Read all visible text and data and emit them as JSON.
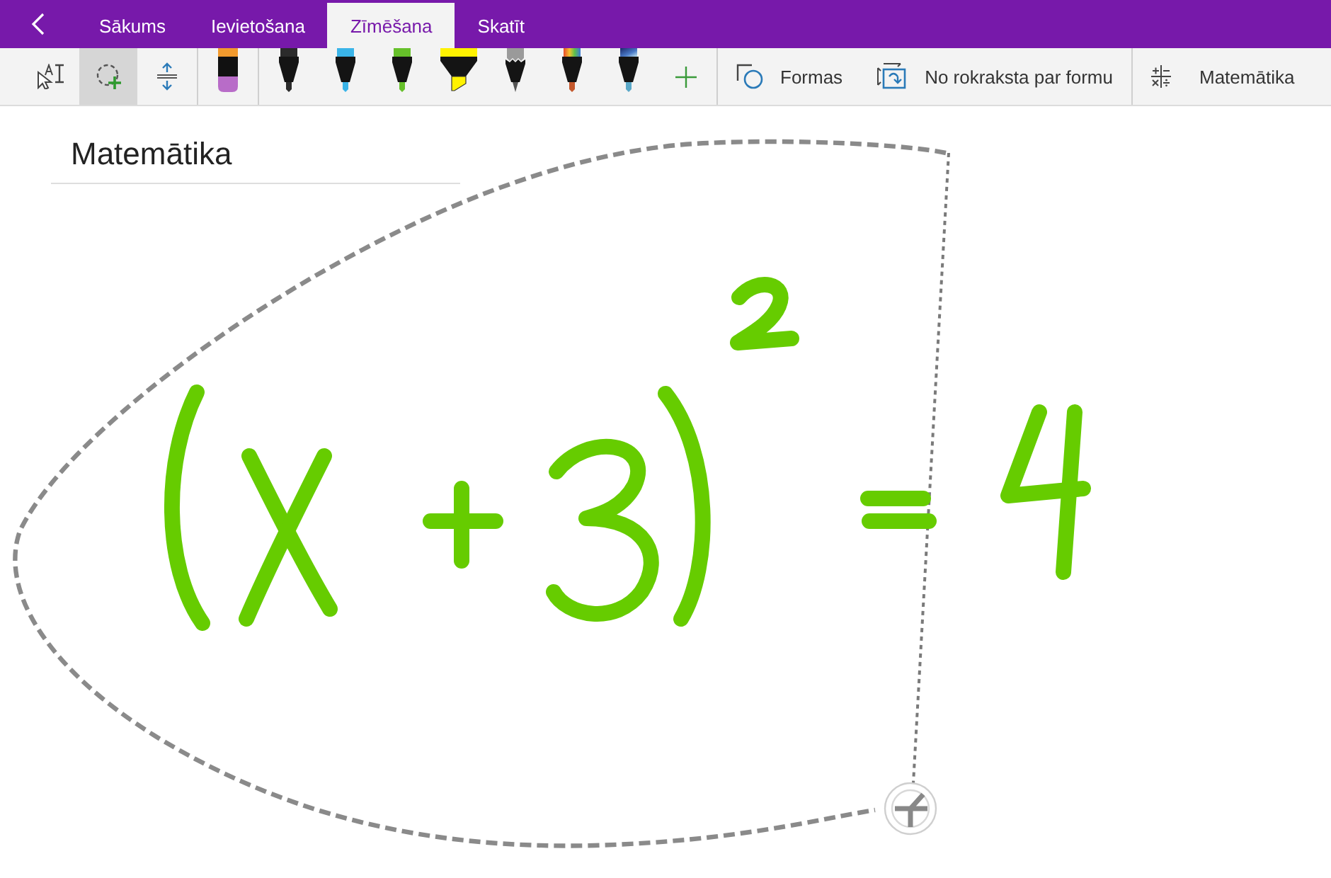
{
  "tabs": [
    {
      "label": "Sākums",
      "selected": false
    },
    {
      "label": "Ievietošana",
      "selected": false
    },
    {
      "label": "Zīmēšana",
      "selected": true
    },
    {
      "label": "Skatīt",
      "selected": false
    }
  ],
  "toolbar": {
    "tools": [
      {
        "kind": "lasso-type",
        "selected": false
      },
      {
        "kind": "lasso-select",
        "selected": true
      },
      {
        "kind": "add-space",
        "selected": false
      }
    ],
    "eraser": {
      "selected": false
    },
    "pens": [
      {
        "kind": "pen",
        "color": "#2b2b2b",
        "selected": false
      },
      {
        "kind": "pen",
        "color": "#3ab4e8",
        "selected": false
      },
      {
        "kind": "pen",
        "color": "#66c02a",
        "selected": false
      },
      {
        "kind": "highlighter",
        "color": "#fff200",
        "selected": false
      },
      {
        "kind": "pencil",
        "color": "#9a9a9a",
        "selected": false
      },
      {
        "kind": "rainbow-pen",
        "selected": false
      },
      {
        "kind": "galaxy-pen",
        "selected": false
      }
    ],
    "actions": [
      {
        "kind": "shapes",
        "label": "Formas"
      },
      {
        "kind": "ink-to-shape",
        "label": "No rokraksta par formu"
      }
    ],
    "math": {
      "label": "Matemātika"
    }
  },
  "page": {
    "title": "Matemātika"
  }
}
